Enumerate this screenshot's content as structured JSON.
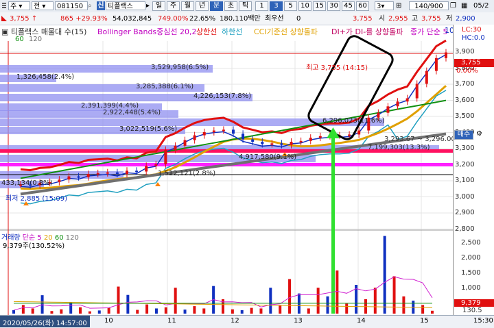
{
  "toolbar": {
    "type_select": "주",
    "market_select": "전",
    "code": "081150",
    "stock_name": "티플랙스",
    "periods": [
      "일",
      "주",
      "월",
      "년",
      "분",
      "초",
      "틱"
    ],
    "active_period": "분",
    "intervals": [
      "1",
      "3",
      "5",
      "10",
      "15",
      "30",
      "45",
      "60"
    ],
    "active_interval": "3",
    "interval_value": "3",
    "count": "140/900",
    "date": "05/2"
  },
  "quote": {
    "price": "3,755",
    "arrow": "↑",
    "change": "865",
    "change_pct": "+29.93%",
    "volume": "54,032,845",
    "ratio": "749.00%",
    "turnover": "22.65%",
    "amount": "180,110백만",
    "best_ask_label": "최우선",
    "best_ask": "0",
    "best_bid": "3,755",
    "open_label": "시",
    "open": "2,955",
    "high_label": "고",
    "high": "3,755",
    "low_label": "저",
    "low": "2,900"
  },
  "legend": {
    "title": "티플랙스 매물대 수(15)",
    "bollinger": "Bollinger Bands중심선 20,2",
    "upper": "상한선",
    "lower": "하한선",
    "cci": "CCI기준선 상향돌파",
    "dmi": "DI+가 DI-를 상향돌파",
    "ma": "종가 단순 5",
    "ma_tail": "10",
    "ma2": "60",
    "ma3": "120"
  },
  "profile_labels": [
    "3,529,958(6.5%)",
    "1,326,458(2.4%)",
    "3,285,388(6.1%)",
    "4,226,153(7.8%)",
    "2,391,399(4.4%)",
    "2,922,448(5.4%)",
    "3,022,519(5.6%)",
    "6,296,023(11.6%)",
    "7,199,303(13.3%)",
    "4,917,580(9.1%)",
    "1,512,121(2.8%)",
    "433,134(0.8%)"
  ],
  "annotations": {
    "high": "최고 3,755 (14:15)",
    "low": "최저 2,885 (15:09)",
    "range": "3,293.67 ~ 3,296.00"
  },
  "price_axis": {
    "ticks": [
      "3,900",
      "3,800",
      "3,700",
      "3,600",
      "3,500",
      "3,400",
      "3,300",
      "3,200",
      "3,100",
      "3,000",
      "2,900",
      "2,800"
    ],
    "current": "3,755",
    "current_pct": "0.00%",
    "lc": "LC:30",
    "hc": "HC:0.0",
    "buy": "매수"
  },
  "volume_panel": {
    "title": "거래량",
    "ma": "단순 5",
    "p20": "20",
    "p60": "60",
    "p120": "120",
    "value": "9,379주(130.52%)",
    "ticks": [
      "2,500",
      "2,000",
      "1,500",
      "1,000",
      "500"
    ],
    "current": "9,379",
    "pct": "130.5"
  },
  "time_axis": {
    "cursor": "2020/05/26(화) 14:57:00",
    "labels": [
      "10",
      "11",
      "12",
      "13",
      "14",
      "15"
    ],
    "end": "15:30"
  },
  "chart_data": {
    "type": "line",
    "price": [
      2935,
      2930,
      2945,
      2950,
      2965,
      2985,
      2980,
      3000,
      3005,
      3010,
      3000,
      3020,
      3015,
      3050,
      3060,
      3150,
      3175,
      3210,
      3240,
      3260,
      3270,
      3275,
      3250,
      3215,
      3200,
      3185,
      3190,
      3180,
      3200,
      3205,
      3225,
      3235,
      3240,
      3240,
      3245,
      3270,
      3350,
      3380,
      3420,
      3450,
      3470,
      3560,
      3640,
      3720,
      3755
    ],
    "volume": [
      120,
      300,
      180,
      640,
      90,
      150,
      400,
      220,
      80,
      110,
      200,
      940,
      650,
      130,
      320,
      180,
      220,
      900,
      140,
      260,
      180,
      960,
      500,
      150,
      120,
      200,
      180,
      900,
      300,
      1200,
      700,
      180,
      900,
      600,
      1500,
      350,
      1000,
      500,
      900,
      2700,
      1300,
      600,
      450,
      300,
      100
    ],
    "colors": {
      "up": "#e01010",
      "down": "#1030c0",
      "ma5": "#d020d0",
      "ma20": "#e0a000",
      "ma60": "#109010",
      "ma120": "#707070",
      "profile": "#8f8ff0",
      "upper": "#e01010",
      "lower": "#20a0c0"
    }
  }
}
